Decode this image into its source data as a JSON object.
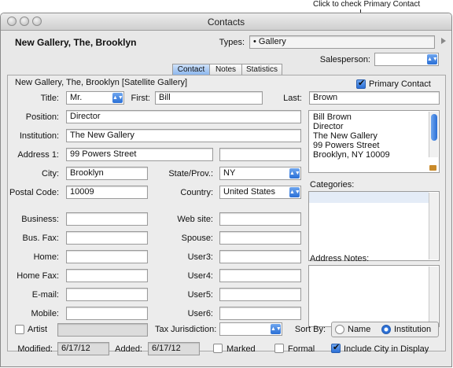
{
  "callout": "Click to check Primary Contact",
  "window": {
    "title": "Contacts"
  },
  "header": {
    "name": "New Gallery, The, Brooklyn",
    "types_label": "Types:",
    "types_value": "• Gallery",
    "salesperson_label": "Salesperson:",
    "salesperson_value": ""
  },
  "tabs": [
    {
      "label": "Contact"
    },
    {
      "label": "Notes"
    },
    {
      "label": "Statistics"
    }
  ],
  "contact": {
    "section_title": "New Gallery, The, Brooklyn [Satellite Gallery]",
    "primary_contact_label": "Primary Contact",
    "title_label": "Title:",
    "title_value": "Mr.",
    "first_label": "First:",
    "first_value": "Bill",
    "last_label": "Last:",
    "last_value": "Brown",
    "position_label": "Position:",
    "position_value": "Director",
    "institution_label": "Institution:",
    "institution_value": "The New Gallery",
    "address1_label": "Address 1:",
    "address1_value": "99 Powers Street",
    "address2_value": "",
    "city_label": "City:",
    "city_value": "Brooklyn",
    "state_label": "State/Prov.:",
    "state_value": "NY",
    "postal_label": "Postal Code:",
    "postal_value": "10009",
    "country_label": "Country:",
    "country_value": "United States",
    "business_label": "Business:",
    "business_value": "",
    "website_label": "Web site:",
    "website_value": "",
    "busfax_label": "Bus. Fax:",
    "busfax_value": "",
    "spouse_label": "Spouse:",
    "spouse_value": "",
    "home_label": "Home:",
    "home_value": "",
    "user3_label": "User3:",
    "user3_value": "",
    "homefax_label": "Home Fax:",
    "homefax_value": "",
    "user4_label": "User4:",
    "user4_value": "",
    "email_label": "E-mail:",
    "email_value": "",
    "user5_label": "User5:",
    "user5_value": "",
    "mobile_label": "Mobile:",
    "mobile_value": "",
    "user6_label": "User6:",
    "user6_value": "",
    "address_block": [
      "Bill Brown",
      "Director",
      "The New Gallery",
      "99 Powers Street",
      "Brooklyn, NY 10009"
    ],
    "categories_label": "Categories:",
    "address_notes_label": "Address Notes:",
    "artist_label": "Artist",
    "tax_label": "Tax Jurisdiction:",
    "tax_value": "",
    "sortby_label": "Sort By:",
    "sort_name_label": "Name",
    "sort_institution_label": "Institution",
    "modified_label": "Modified:",
    "modified_value": "6/17/12",
    "added_label": "Added:",
    "added_value": "6/17/12",
    "marked_label": "Marked",
    "formal_label": "Formal",
    "include_city_label": "Include City in Display"
  },
  "state": {
    "primary_contact": true,
    "artist": false,
    "marked": false,
    "formal": false,
    "include_city": true,
    "sort_by": "Institution"
  }
}
